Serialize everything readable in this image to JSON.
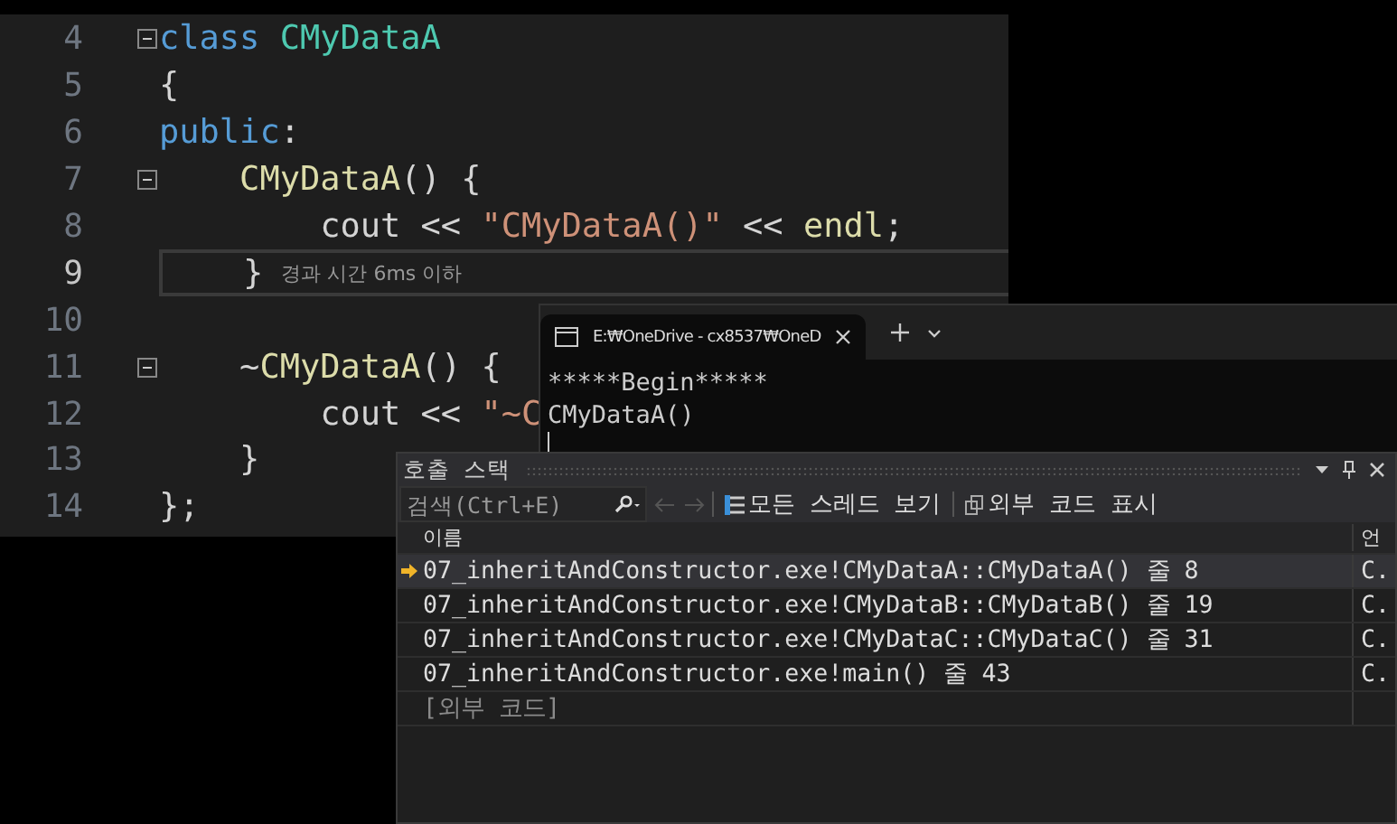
{
  "editor": {
    "lines": [
      {
        "number": "4",
        "current": false,
        "fold": true,
        "tokens": [
          {
            "text": "class ",
            "kind": "keyword"
          },
          {
            "text": "CMyDataA",
            "kind": "type"
          }
        ]
      },
      {
        "number": "5",
        "current": false,
        "fold": false,
        "tokens": [
          {
            "text": "{",
            "kind": "plain"
          }
        ]
      },
      {
        "number": "6",
        "current": false,
        "fold": false,
        "tokens": [
          {
            "text": "public",
            "kind": "keyword"
          },
          {
            "text": ":",
            "kind": "plain"
          }
        ]
      },
      {
        "number": "7",
        "current": false,
        "fold": true,
        "tokens": [
          {
            "text": "    CMyDataA",
            "kind": "func"
          },
          {
            "text": "() {",
            "kind": "plain"
          }
        ]
      },
      {
        "number": "8",
        "current": false,
        "fold": false,
        "tokens": [
          {
            "text": "        cout << ",
            "kind": "plain"
          },
          {
            "text": "\"CMyDataA()\"",
            "kind": "string"
          },
          {
            "text": " << ",
            "kind": "plain"
          },
          {
            "text": "endl",
            "kind": "func"
          },
          {
            "text": ";",
            "kind": "plain"
          }
        ]
      },
      {
        "number": "9",
        "current": true,
        "fold": false,
        "hint": "경과 시간 6ms 이하",
        "tokens": [
          {
            "text": "    }",
            "kind": "plain"
          }
        ]
      },
      {
        "number": "10",
        "current": false,
        "fold": false
      },
      {
        "number": "11",
        "current": false,
        "fold": true,
        "tokens": [
          {
            "text": "    ~",
            "kind": "plain"
          },
          {
            "text": "CMyDataA",
            "kind": "func"
          },
          {
            "text": "() {",
            "kind": "plain"
          }
        ]
      },
      {
        "number": "12",
        "current": false,
        "fold": false,
        "tokens": [
          {
            "text": "        cout << ",
            "kind": "plain"
          },
          {
            "text": "\"~C",
            "kind": "string"
          }
        ]
      },
      {
        "number": "13",
        "current": false,
        "fold": false,
        "tokens": [
          {
            "text": "    }",
            "kind": "plain"
          }
        ]
      },
      {
        "number": "14",
        "current": false,
        "fold": false,
        "tokens": [
          {
            "text": "};",
            "kind": "plain"
          }
        ]
      }
    ]
  },
  "console": {
    "tab_title": "E:₩OneDrive - cx8537₩OneD",
    "output": [
      "*****Begin*****",
      "CMyDataA()"
    ]
  },
  "call_stack": {
    "title": "호출 스택",
    "search": {
      "placeholder": "검색(Ctrl+E)"
    },
    "toolbar": [
      {
        "label": "모든 스레드 보기",
        "kind": "threads"
      },
      {
        "label": "외부 코드 표시",
        "kind": "external"
      }
    ],
    "columns": [
      "이름",
      "언"
    ],
    "rows": [
      {
        "name": "07_inheritAndConstructor.exe!CMyDataA::CMyDataA() 줄 8",
        "language": "C.",
        "selected": true,
        "kind": "frame"
      },
      {
        "name": "07_inheritAndConstructor.exe!CMyDataB::CMyDataB() 줄 19",
        "language": "C.",
        "selected": false,
        "kind": "frame"
      },
      {
        "name": "07_inheritAndConstructor.exe!CMyDataC::CMyDataC() 줄 31",
        "language": "C.",
        "selected": false,
        "kind": "frame"
      },
      {
        "name": "07_inheritAndConstructor.exe!main() 줄 43",
        "language": "C.",
        "selected": false,
        "kind": "frame"
      },
      {
        "name": "[외부 코드]",
        "selected": false,
        "kind": "external"
      }
    ]
  }
}
